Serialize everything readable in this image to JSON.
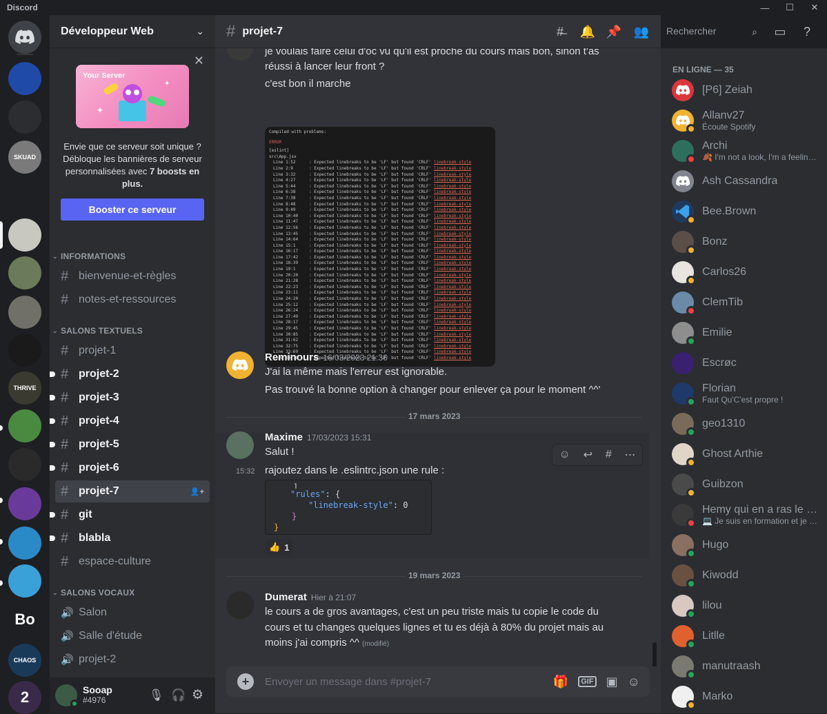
{
  "app": {
    "title": "Discord"
  },
  "colors": {
    "accent": "#5865f2",
    "online": "#23a55a",
    "idle": "#f0b232",
    "dnd": "#f23f43",
    "link": "#00a8fc"
  },
  "server": {
    "name": "Développeur Web",
    "boost": {
      "banner_label": "Your Server",
      "text_before": "Envie que ce serveur soit unique ? Débloque les bannières de serveur personnalisées avec ",
      "text_bold": "7 boosts en plus.",
      "button": "Booster ce serveur"
    },
    "categories": {
      "informations": "INFORMATIONS",
      "textuels": "SALONS TEXTUELS",
      "vocaux": "SALONS VOCAUX"
    },
    "info_channels": [
      "bienvenue-et-règles",
      "notes-et-ressources"
    ],
    "text_channels": [
      "projet-1",
      "projet-2",
      "projet-3",
      "projet-4",
      "projet-5",
      "projet-6",
      "projet-7",
      "git",
      "blabla",
      "espace-culture"
    ],
    "voice_channels": [
      "Salon",
      "Salle d'étude",
      "projet-2"
    ]
  },
  "user": {
    "name": "Sooap",
    "tag": "#4976"
  },
  "channel": {
    "name": "projet-7",
    "search_placeholder": "Rechercher",
    "composer_placeholder": "Envoyer un message dans #projet-7"
  },
  "messages": {
    "m0_line1": "je voulais faire celui d'oc vu qu'il est proche du cours mais bon, sinon t'as",
    "m0_line2": "réussi à lancer leur front ?",
    "m0_line3": "c'est bon il marche",
    "error_image": {
      "header": "Compiled with problems:",
      "error": "ERROR",
      "eslint": "[eslint]",
      "file": "src\\App.jsx",
      "rule_text": "Expected linebreaks to be 'LF' but found 'CRLF'",
      "rule": "linebreak-style",
      "lines": [
        "1:52",
        "2:9",
        "3:32",
        "4:27",
        "5:44",
        "6:38",
        "7:38",
        "8:48",
        "9:49",
        "10:40",
        "11:47",
        "12:56",
        "13:45",
        "14:64",
        "15:1",
        "16:17",
        "17:42",
        "18:39",
        "19:1",
        "20:20",
        "21:28",
        "22:23",
        "23:11",
        "24:20",
        "25:12",
        "26:24",
        "27:49",
        "28:17",
        "29:45",
        "30:85",
        "31:62",
        "32:75",
        "33:69",
        "34:18"
      ]
    },
    "reminours": {
      "author": "Reminours",
      "time": "16/03/2023 21:36",
      "line1": "J'ai la même mais l'erreur est ignorable.",
      "line2": "Pas trouvé la bonne option à changer pour enlever ça pour le moment ^^'"
    },
    "date1": "17 mars 2023",
    "maxime": {
      "author": "Maxime",
      "time": "17/03/2023 15:31",
      "line1": "Salut !",
      "side_time": "15:32",
      "line2": "rajoutez dans le .eslintrc.json une rule :",
      "code_l0": "],",
      "code_key": "\"rules\"",
      "code_brace": ": {",
      "code_rule": "\"linebreak-style\"",
      "code_val": ": 0",
      "code_close1": "}",
      "code_close2": "}",
      "reaction": "👍",
      "reaction_count": "1"
    },
    "date2": "19 mars 2023",
    "dumerat": {
      "author": "Dumerat",
      "time": "Hier à 21:07",
      "line1": "le cours a de gros avantages, c'est un peu triste mais tu copie le code du",
      "line2": "cours et tu changes quelques lignes et tu es déjà à 80% du projet mais au",
      "line3": "moins j'ai compris ^^",
      "edited": "(modifié)"
    }
  },
  "members": {
    "header": "EN LIGNE — 35",
    "list": [
      {
        "name": "[P6] Zeiah",
        "sub": "",
        "status": "none",
        "color": "#da373c",
        "icon": "discord-logo"
      },
      {
        "name": "Allanv27",
        "sub": "Écoute Spotify",
        "status": "idle",
        "color": "#f0b232",
        "icon": "discord-logo"
      },
      {
        "name": "Archi",
        "sub": "🍂 I'm not a look, I'm a feeling...",
        "status": "dnd",
        "color": "#2e6e5c",
        "icon": ""
      },
      {
        "name": "Ash Cassandra",
        "sub": "",
        "status": "none",
        "color": "#80848e",
        "icon": "discord-logo"
      },
      {
        "name": "Bee.Brown",
        "sub": "",
        "status": "idle",
        "color": "#1e3a5f",
        "icon": "vscode"
      },
      {
        "name": "Bonz",
        "sub": "",
        "status": "idle",
        "color": "#5a4e48",
        "icon": ""
      },
      {
        "name": "Carlos26",
        "sub": "",
        "status": "idle",
        "color": "#e8e4e0",
        "icon": ""
      },
      {
        "name": "ClemTib",
        "sub": "",
        "status": "dnd",
        "color": "#6a8aa8",
        "icon": ""
      },
      {
        "name": "Emilie",
        "sub": "",
        "status": "online",
        "color": "#8e8e8e",
        "icon": ""
      },
      {
        "name": "Escrøc",
        "sub": "",
        "status": "none",
        "color": "#3a2070",
        "icon": ""
      },
      {
        "name": "Florian",
        "sub": "Faut Qu'C'est propre !",
        "status": "online",
        "color": "#1e3a6a",
        "icon": ""
      },
      {
        "name": "geo1310",
        "sub": "",
        "status": "online",
        "color": "#7a6a5a",
        "icon": ""
      },
      {
        "name": "Ghost Arthie",
        "sub": "",
        "status": "idle",
        "color": "#e0d6c8",
        "icon": ""
      },
      {
        "name": "Guibzon",
        "sub": "",
        "status": "idle",
        "color": "#4a4a4a",
        "icon": ""
      },
      {
        "name": "Hemy qui en a ras le c...",
        "sub": "💻 Je suis en formation et je t...",
        "status": "dnd",
        "color": "#3a3a3a",
        "icon": ""
      },
      {
        "name": "Hugo",
        "sub": "",
        "status": "online",
        "color": "#8a7060",
        "icon": ""
      },
      {
        "name": "Kiwodd",
        "sub": "",
        "status": "online",
        "color": "#6a5040",
        "icon": ""
      },
      {
        "name": "lilou",
        "sub": "",
        "status": "online",
        "color": "#d8c8c0",
        "icon": ""
      },
      {
        "name": "Litlle",
        "sub": "",
        "status": "online",
        "color": "#e06030",
        "icon": ""
      },
      {
        "name": "manutraash",
        "sub": "",
        "status": "online",
        "color": "#7a7a70",
        "icon": ""
      },
      {
        "name": "Marko",
        "sub": "",
        "status": "idle",
        "color": "#f0f0f0",
        "icon": ""
      }
    ]
  },
  "servers": [
    {
      "label": "",
      "color": "#1f4aa8"
    },
    {
      "label": "",
      "color": "#2b2d31"
    },
    {
      "label": "SKUAD",
      "color": "#7a7a7a"
    },
    {
      "label": "",
      "color": "#1e1f22"
    },
    {
      "label": "",
      "color": "#c8c8c0"
    },
    {
      "label": "",
      "color": "#6a7a5a"
    },
    {
      "label": "",
      "color": "#707068"
    },
    {
      "label": "",
      "color": "#1a1a1a"
    },
    {
      "label": "THRIVE",
      "color": "#3a3a30"
    },
    {
      "label": "",
      "color": "#4a8a40"
    },
    {
      "label": "",
      "color": "#2a2a2a"
    },
    {
      "label": "",
      "color": "#6a3a9a"
    },
    {
      "label": "",
      "color": "#2a8ac8"
    },
    {
      "label": "",
      "color": "#3aa0d8"
    },
    {
      "label": "Bo",
      "color": "#1e1f22"
    },
    {
      "label": "CHAOS",
      "color": "#1a3a5a"
    },
    {
      "label": "2",
      "color": "#3a2a4a"
    }
  ]
}
